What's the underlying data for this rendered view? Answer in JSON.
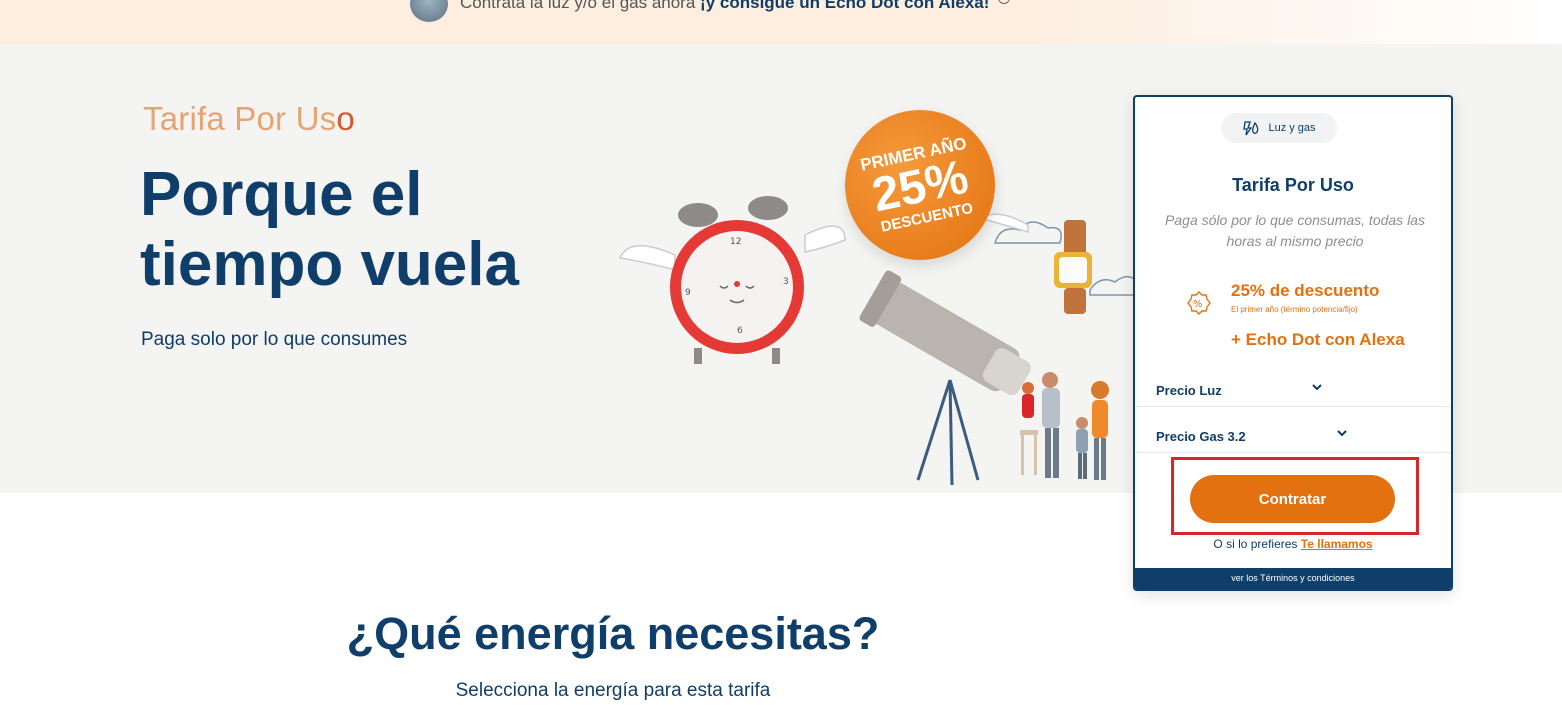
{
  "topbar": {
    "message_prefix": "Contrata la luz y/o el gas ahora",
    "message_bold": "¡y consigue un Echo Dot con Alexa!"
  },
  "hero": {
    "brand": "Tarifa Por Us",
    "brand_power": "o",
    "headline_line1": "Porque el",
    "headline_line2": "tiempo vuela",
    "subtitle": "Paga solo por lo que consumes",
    "badge": {
      "line1": "PRIMER AÑO",
      "line2": "25%",
      "line3": "DESCUENTO"
    }
  },
  "card": {
    "energy_pill": "Luz y gas",
    "title": "Tarifa Por Uso",
    "description": "Paga sólo por lo que consumas, todas las horas al mismo precio",
    "promo_main": "25% de descuento",
    "promo_note": "El primer año (término potencia/fijo)",
    "promo_extra": "+ Echo Dot con Alexa",
    "price_luz": "Precio Luz",
    "price_gas": "Precio Gas 3.2",
    "cta": "Contratar",
    "callback_prefix": "O si lo prefieres",
    "callback_link": "Te llamamos",
    "terms": "ver los Términos y condiciones"
  },
  "energy_section": {
    "title": "¿Qué energía necesitas?",
    "subtitle": "Selecciona la energía para esta tarifa"
  },
  "colors": {
    "navy": "#0e3e69",
    "orange": "#e4710f",
    "highlight_red": "#d9262a"
  }
}
